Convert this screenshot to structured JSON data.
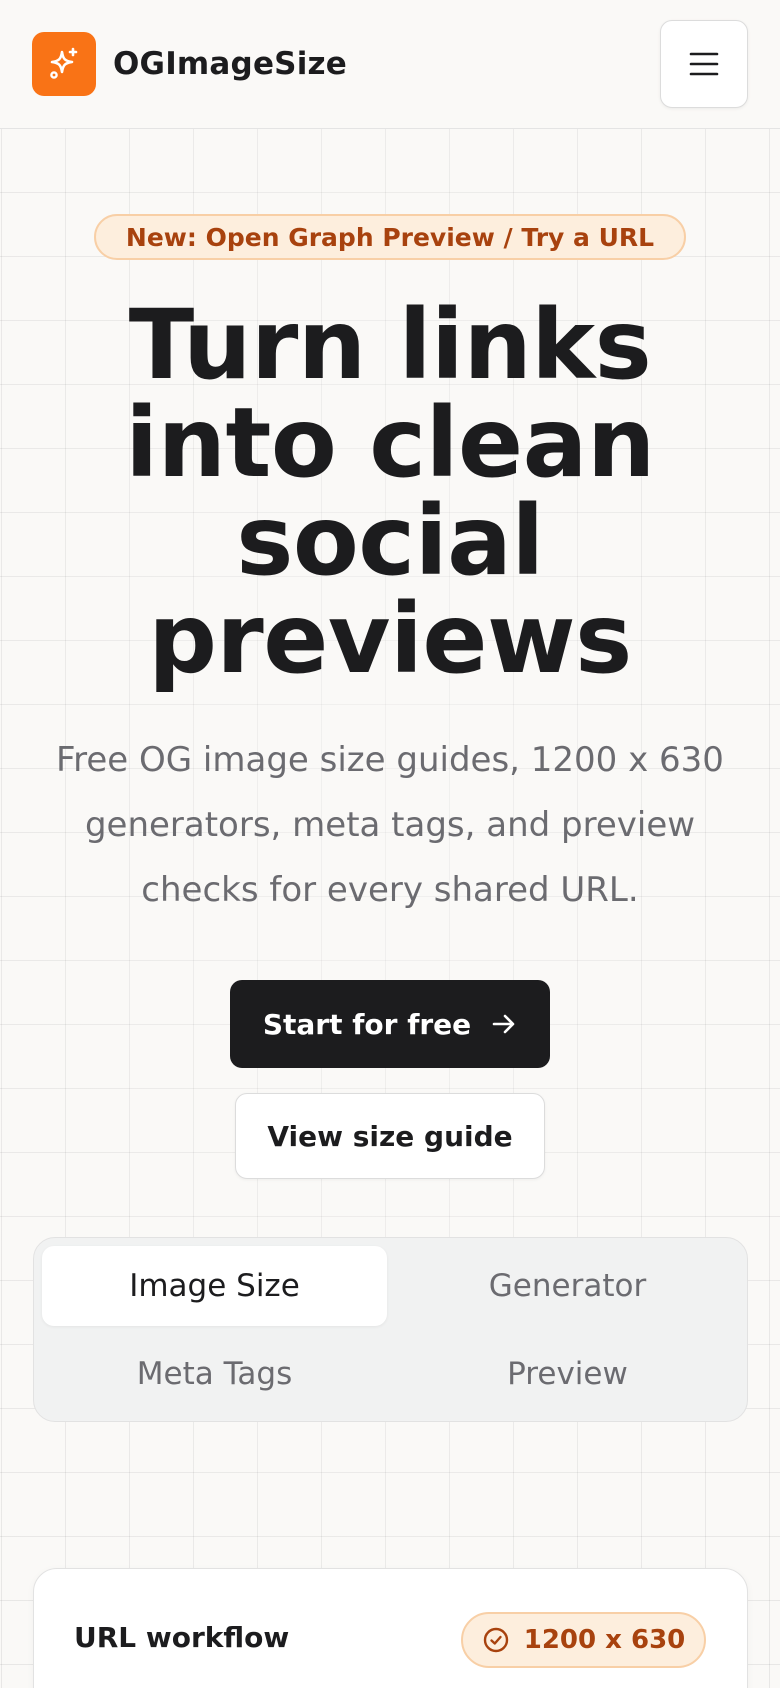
{
  "header": {
    "brand_name": "OGImageSize",
    "logo_icon": "sparkle-icon",
    "menu_icon": "hamburger-icon"
  },
  "hero": {
    "badge": "New: Open Graph Preview / Try a URL",
    "title_lines": [
      "Turn links",
      "into clean",
      "social",
      "previews"
    ],
    "subtitle": "Free OG image size guides, 1200 x 630 generators, meta tags, and preview checks for every shared URL.",
    "primary_cta": "Start for free",
    "primary_cta_icon": "arrow-right-icon",
    "secondary_cta": "View size guide"
  },
  "tabs": {
    "items": [
      "Image Size",
      "Generator",
      "Meta Tags",
      "Preview"
    ],
    "active": "Image Size"
  },
  "card": {
    "title": "URL workflow",
    "size_badge": "1200 x 630",
    "size_badge_icon": "check-circle-icon"
  },
  "colors": {
    "accent": "#f97316",
    "accent_text": "#a8420e",
    "accent_bg": "#fdeedd",
    "dark": "#1c1c1e",
    "muted": "#6b6b70"
  }
}
